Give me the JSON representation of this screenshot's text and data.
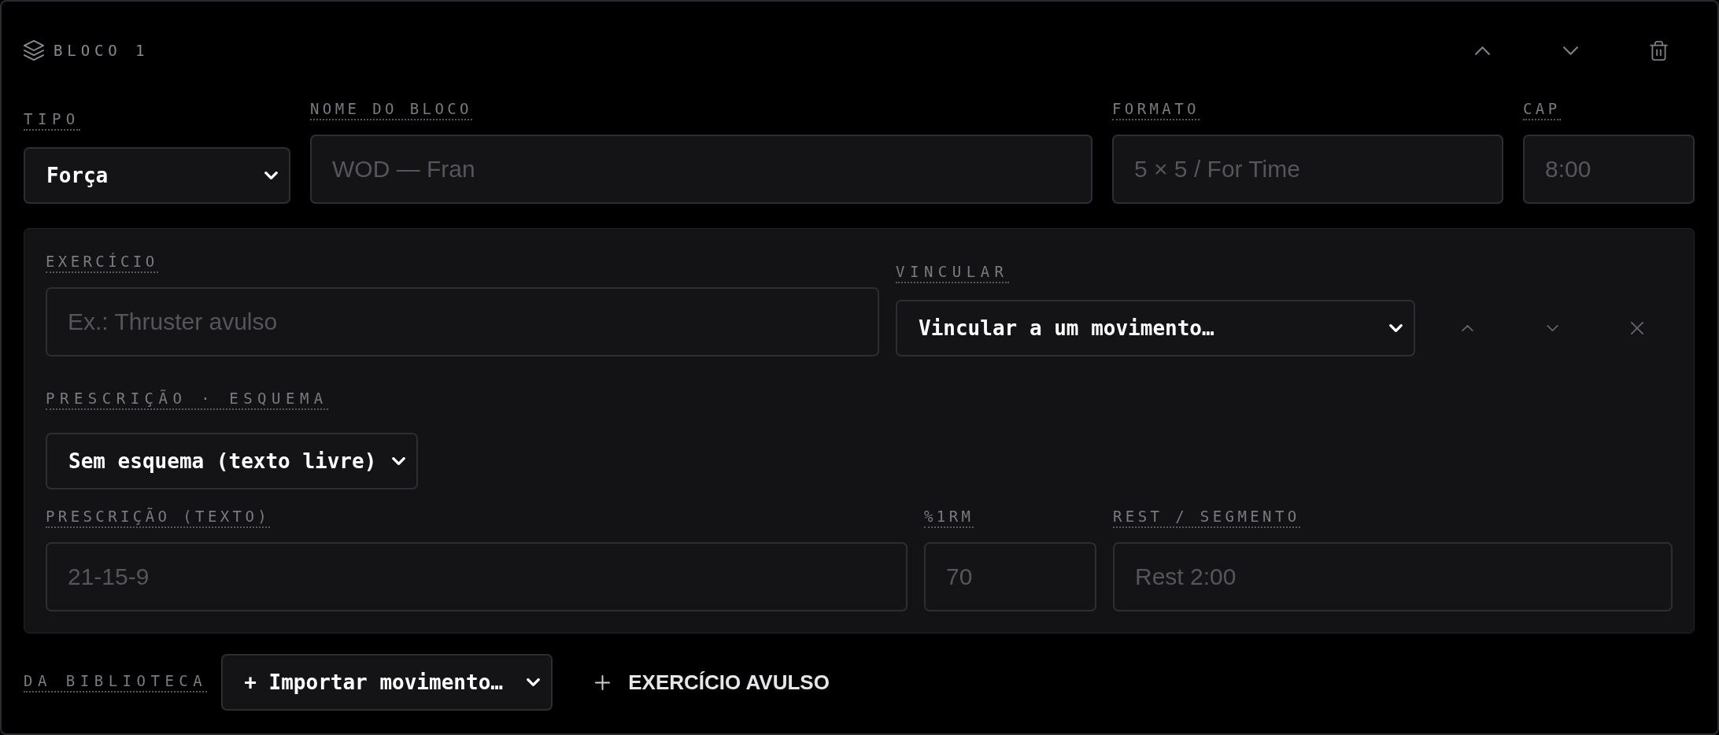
{
  "block": {
    "title": "BLOCO 1",
    "fields": [
      {
        "kind": "select",
        "label": "TIPO",
        "value": "Força"
      },
      {
        "kind": "input",
        "label": "NOME DO BLOCO",
        "placeholder": "WOD — Fran"
      },
      {
        "kind": "input",
        "label": "FORMATO",
        "placeholder": "5 × 5 / For Time"
      },
      {
        "kind": "input",
        "label": "CAP",
        "placeholder": "8:00"
      }
    ]
  },
  "exercise": {
    "fields": [
      {
        "kind": "input",
        "label": "EXERCÍCIO",
        "placeholder": "Ex.: Thruster avulso"
      },
      {
        "kind": "select",
        "label": "VINCULAR",
        "value": "Vincular a um movimento…"
      }
    ],
    "scheme": {
      "kind": "select",
      "label": "PRESCRIÇÃO · ESQUEMA",
      "value": "Sem esquema (texto livre)"
    },
    "prescription": [
      {
        "kind": "input",
        "label": "PRESCRIÇÃO (TEXTO)",
        "placeholder": "21-15-9"
      },
      {
        "kind": "input",
        "label": "%1RM",
        "placeholder": "70"
      },
      {
        "kind": "input",
        "label": "REST / SEGMENTO",
        "placeholder": "Rest 2:00"
      }
    ]
  },
  "footer": {
    "library": {
      "kind": "select",
      "label": "DA BIBLIOTECA",
      "value": "+ Importar movimento…"
    },
    "add_button": {
      "label": "EXERCÍCIO AVULSO"
    }
  }
}
